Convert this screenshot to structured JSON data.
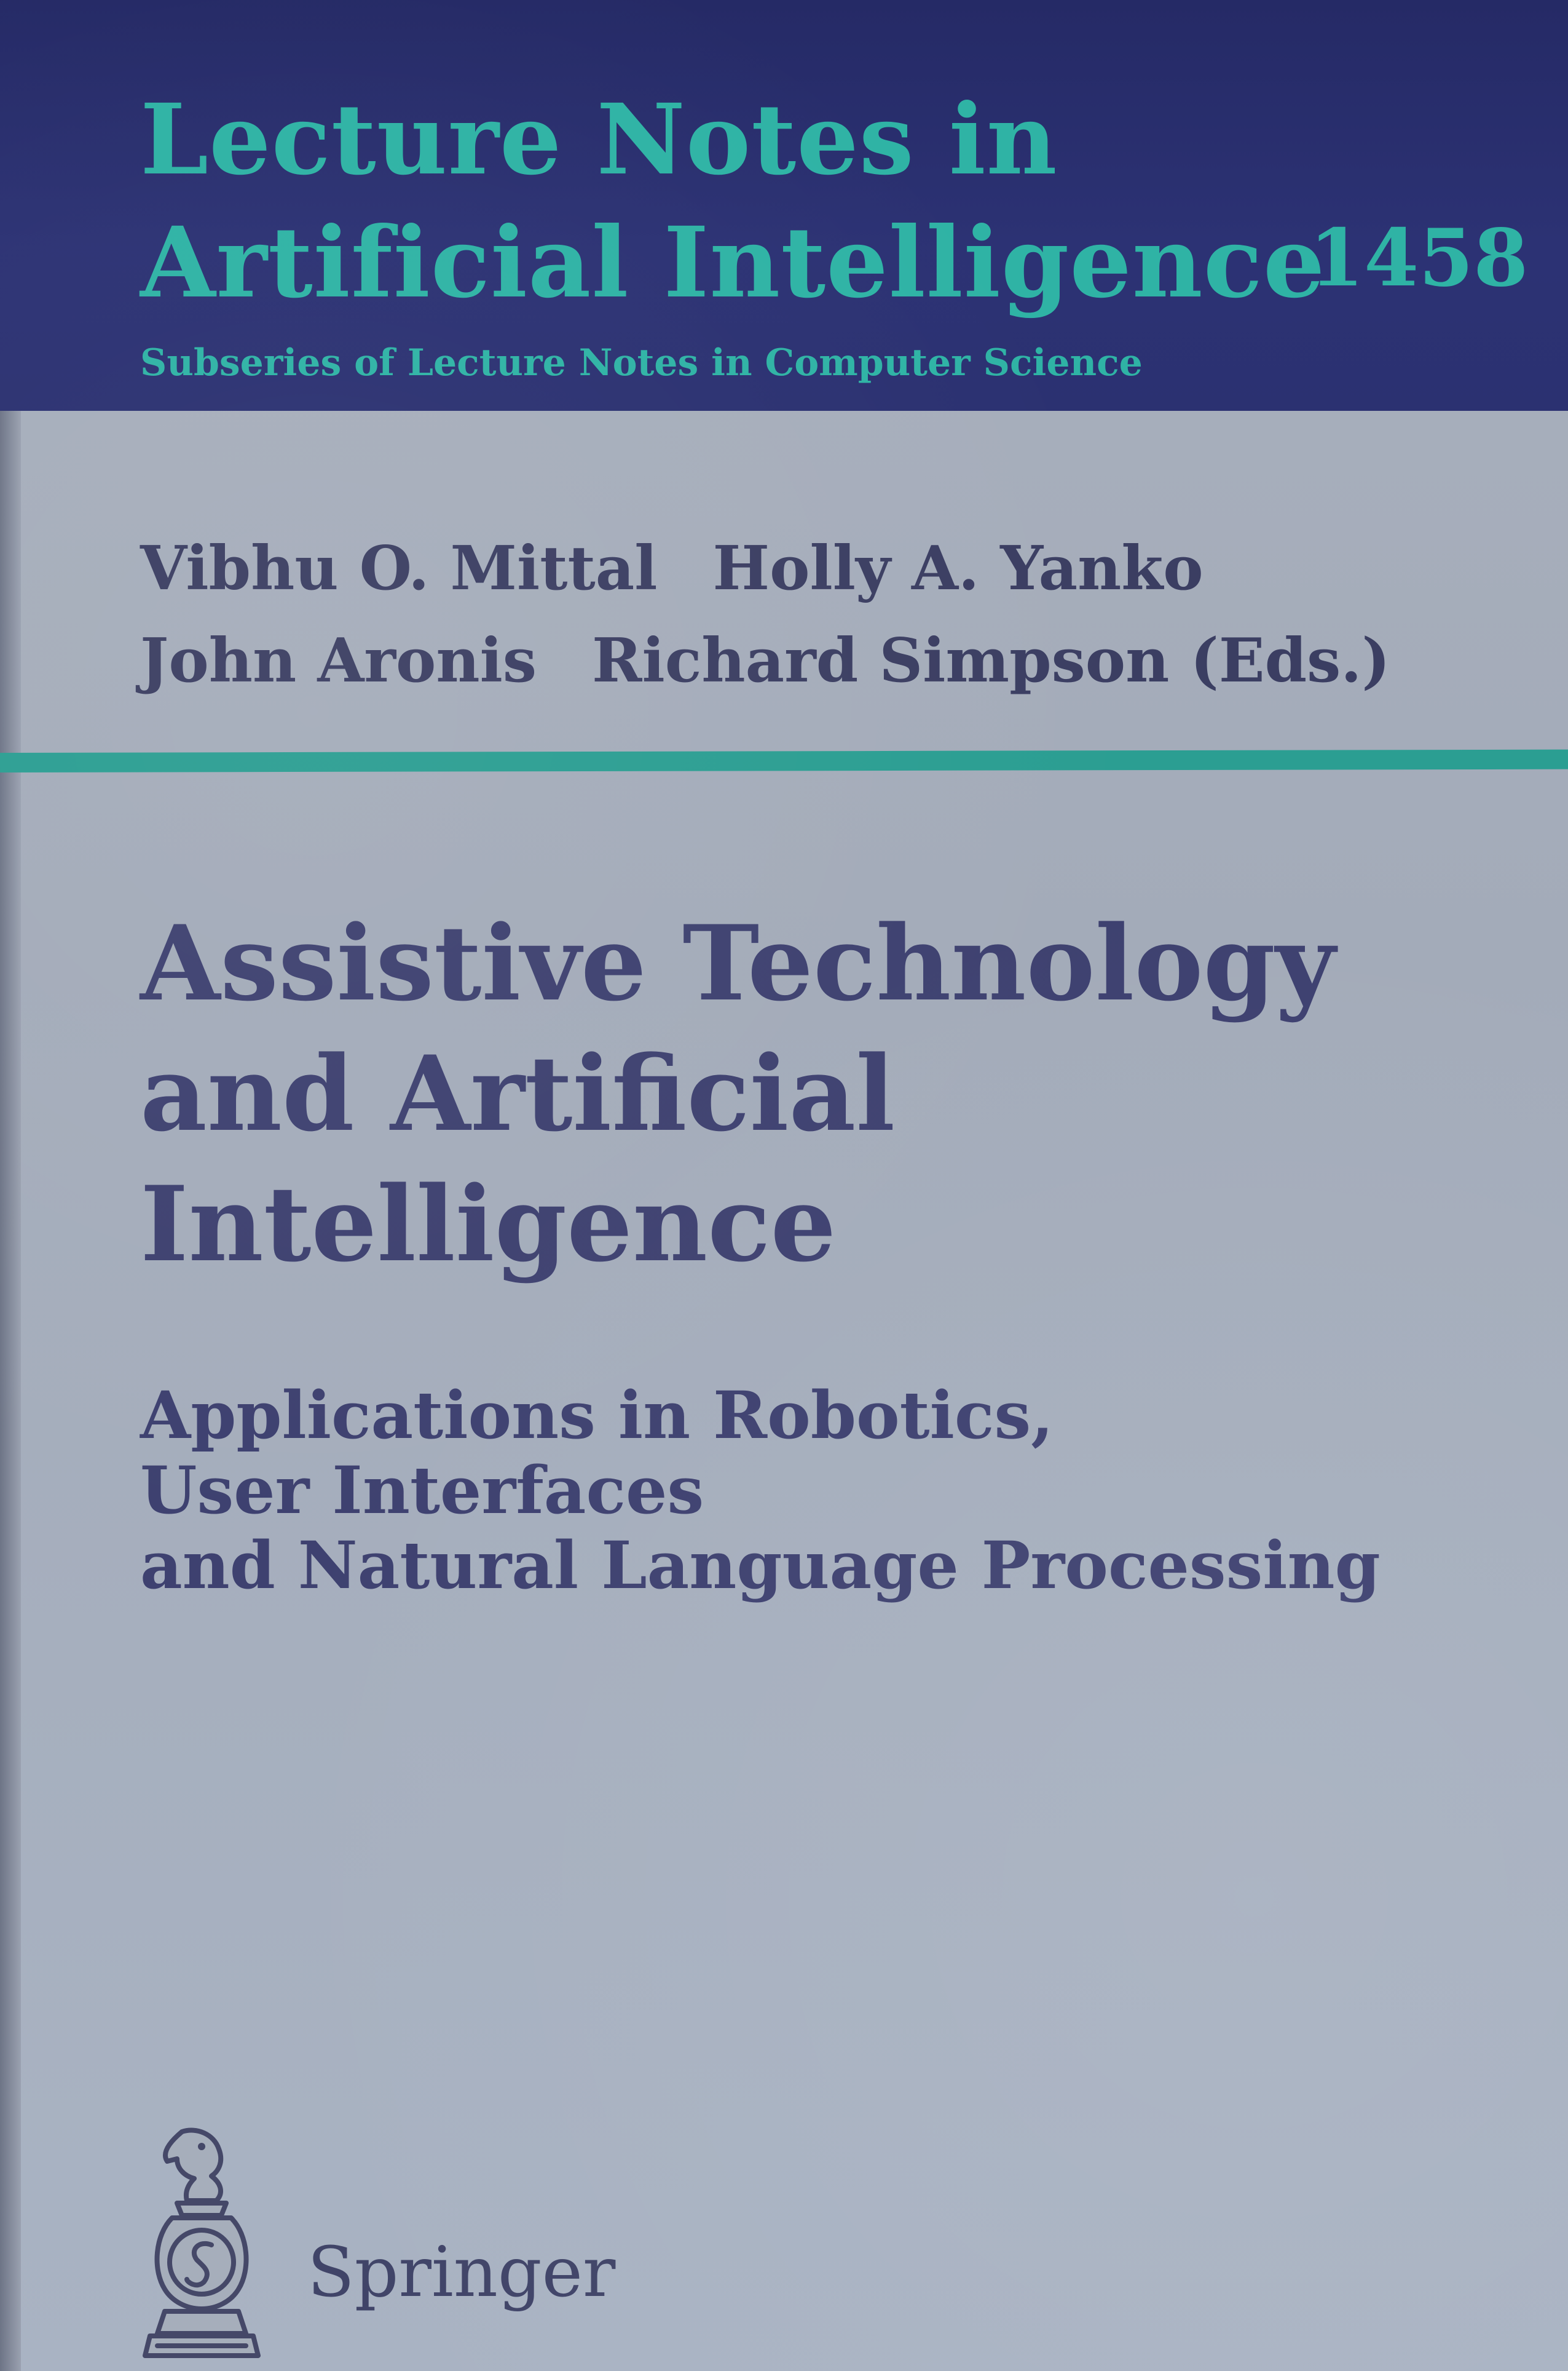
{
  "cover": {
    "series": {
      "line1": "Lecture Notes in",
      "line2": "Artificial Intelligence",
      "volume": "1458",
      "subseries": "Subseries of Lecture Notes in Computer Science"
    },
    "editors": {
      "row1": [
        "Vibhu O. Mittal",
        "Holly A. Yanko"
      ],
      "row2": [
        "John Aronis",
        "Richard Simpson"
      ],
      "suffix": "(Eds.)"
    },
    "title": {
      "line1": "Assistive Technology",
      "line2": "and Artificial",
      "line3": "Intelligence"
    },
    "subtitle": {
      "line1": "Applications in Robotics,",
      "line2": "User Interfaces",
      "line3": "and Natural Language Processing"
    },
    "publisher": {
      "name": "Springer",
      "logo_icon": "springer-chess-knight-icon"
    },
    "colors": {
      "header_band": "#2c3274",
      "accent_teal": "#2fb3a5",
      "cover_gray": "#a6aebb",
      "text_ink": "#3e4170"
    }
  }
}
